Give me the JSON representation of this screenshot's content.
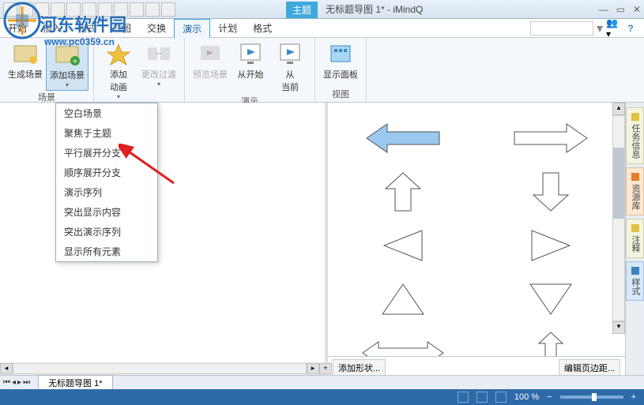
{
  "titlebar": {
    "top_tab_active": "主题",
    "document_title": "无标题导图 1* - iMindQ"
  },
  "watermark": {
    "text": "河东软件园",
    "url": "www.pc0359.cn"
  },
  "menubar": {
    "items": [
      "开始",
      "插入",
      "格式",
      "视图",
      "交换",
      "演示",
      "计划",
      "格式"
    ],
    "active_index": 5
  },
  "ribbon": {
    "group1": {
      "btn1": "生成场景",
      "btn2": "添加场景",
      "label": "场景"
    },
    "group2": {
      "btn1": "添加\n动画",
      "btn2": "更改过渡",
      "label": ""
    },
    "group3": {
      "btn1": "预览场景",
      "btn2": "从开始",
      "btn3": "从\n当前",
      "label": "演示"
    },
    "group4": {
      "btn1": "显示面板",
      "label": "视图"
    }
  },
  "dropdown": {
    "items": [
      "空白场景",
      "聚焦于主题",
      "平行展开分支",
      "顺序展开分支",
      "演示序列",
      "突出显示内容",
      "突出演示序列",
      "显示所有元素"
    ]
  },
  "right_footer": {
    "add_shape": "添加形状...",
    "edit_margin": "编辑页边距..."
  },
  "side_panels": [
    "任务信息",
    "资源库",
    "注释",
    "样式"
  ],
  "doctab": {
    "name": "无标题导图 1*"
  },
  "statusbar": {
    "zoom": "100 %"
  }
}
